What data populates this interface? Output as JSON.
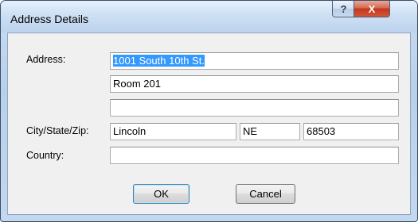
{
  "window": {
    "title": "Address Details",
    "help_glyph": "?",
    "close_glyph": "X"
  },
  "form": {
    "address_label": "Address:",
    "address_line1": "1001 South 10th St.",
    "address_line2": "Room 201",
    "address_line3": "",
    "city_state_zip_label": "City/State/Zip:",
    "city": "Lincoln",
    "state": "NE",
    "zip": "68503",
    "country_label": "Country:",
    "country": ""
  },
  "buttons": {
    "ok_label": "OK",
    "cancel_label": "Cancel"
  },
  "colors": {
    "selection": "#3399ff",
    "close_button": "#c4381f"
  }
}
